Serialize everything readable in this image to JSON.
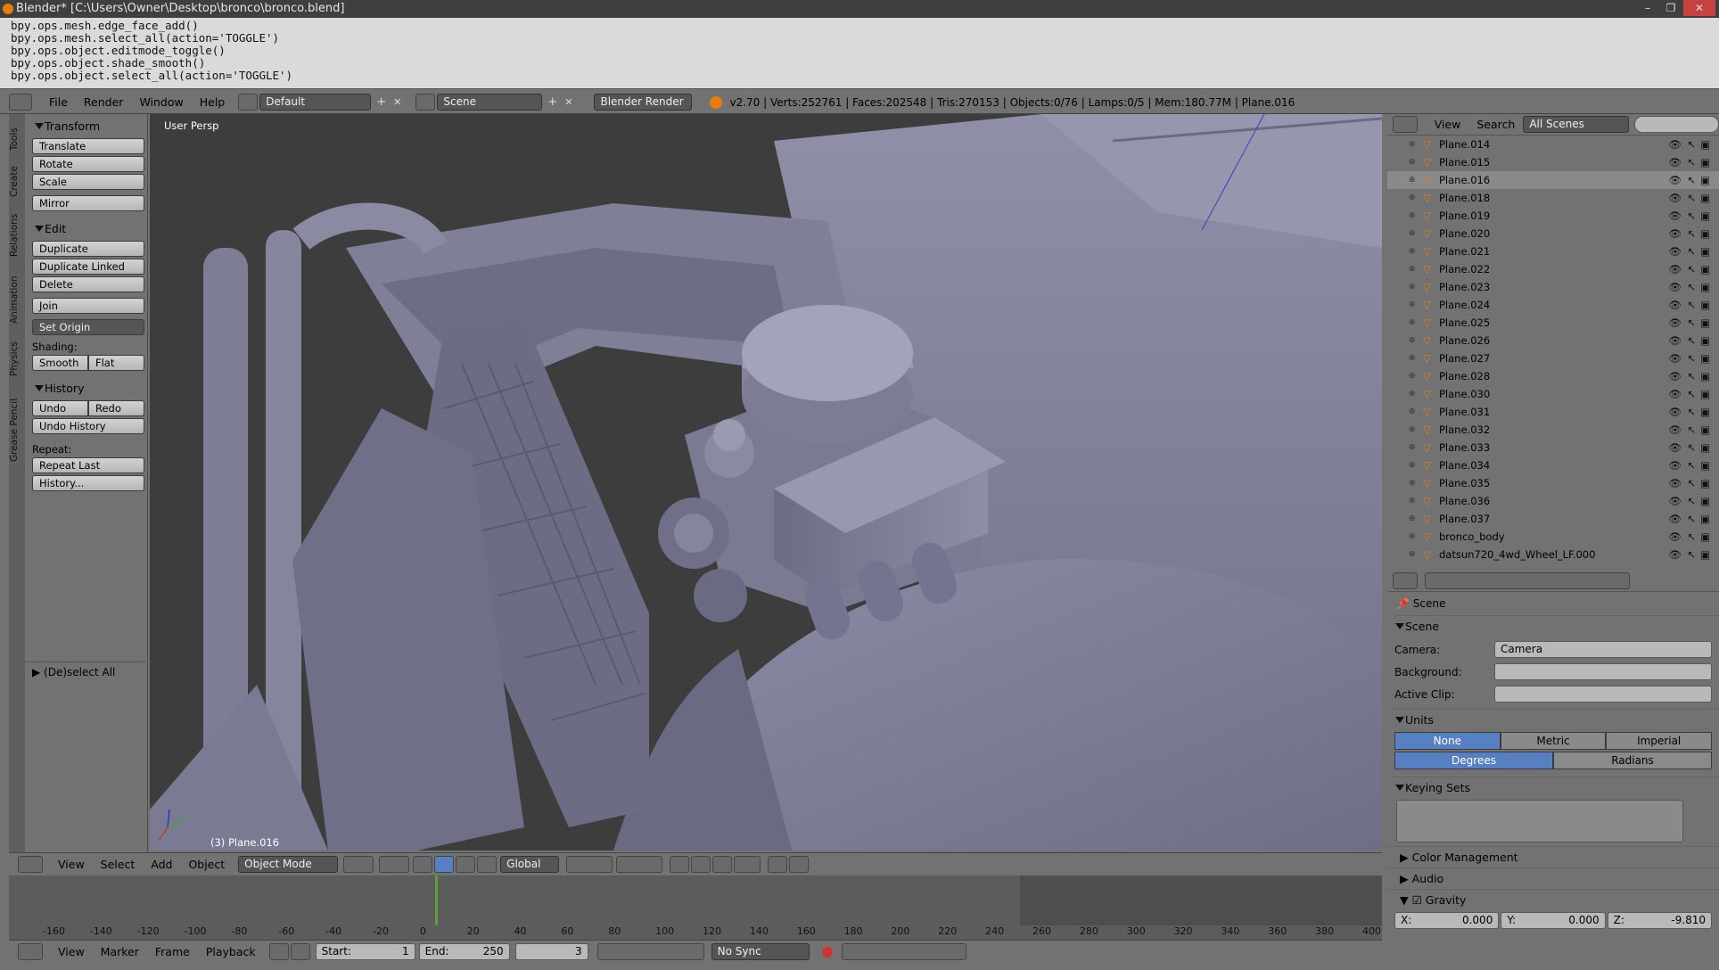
{
  "window": {
    "title": "Blender* [C:\\Users\\Owner\\Desktop\\bronco\\bronco.blend]",
    "buttons": [
      "–",
      "❐",
      "✕"
    ]
  },
  "info_log": [
    "bpy.ops.mesh.edge_face_add()",
    "bpy.ops.mesh.select_all(action='TOGGLE')",
    "bpy.ops.object.editmode_toggle()",
    "bpy.ops.object.shade_smooth()",
    "bpy.ops.object.select_all(action='TOGGLE')"
  ],
  "top_header": {
    "menus": [
      "File",
      "Render",
      "Window",
      "Help"
    ],
    "layout": "Default",
    "scene": "Scene",
    "engine": "Blender Render",
    "stats": "v2.70 | Verts:252761 | Faces:202548 | Tris:270153 | Objects:0/76 | Lamps:0/5 | Mem:180.77M | Plane.016"
  },
  "tool_shelf": {
    "tabs": [
      "Tools",
      "Create",
      "Relations",
      "Animation",
      "Physics",
      "Grease Pencil"
    ],
    "transform": {
      "title": "Transform",
      "buttons": [
        "Translate",
        "Rotate",
        "Scale",
        "Mirror"
      ]
    },
    "edit": {
      "title": "Edit",
      "buttons": [
        "Duplicate",
        "Duplicate Linked",
        "Delete",
        "Join"
      ],
      "set_origin": "Set Origin",
      "shading_label": "Shading:",
      "smooth": "Smooth",
      "flat": "Flat"
    },
    "history": {
      "title": "History",
      "undo": "Undo",
      "redo": "Redo",
      "undo_history": "Undo History",
      "repeat_label": "Repeat:",
      "repeat_last": "Repeat Last",
      "history": "History..."
    },
    "operator": "(De)select All"
  },
  "viewport": {
    "view_label": "User Persp",
    "object_label": "(3) Plane.016"
  },
  "viewport_header": {
    "menus": [
      "View",
      "Select",
      "Add",
      "Object"
    ],
    "mode": "Object Mode",
    "orientation": "Global"
  },
  "outliner": {
    "menus": [
      "View",
      "Search"
    ],
    "filter": "All Scenes",
    "items": [
      "Plane.014",
      "Plane.015",
      "Plane.016",
      "Plane.018",
      "Plane.019",
      "Plane.020",
      "Plane.021",
      "Plane.022",
      "Plane.023",
      "Plane.024",
      "Plane.025",
      "Plane.026",
      "Plane.027",
      "Plane.028",
      "Plane.030",
      "Plane.031",
      "Plane.032",
      "Plane.033",
      "Plane.034",
      "Plane.035",
      "Plane.036",
      "Plane.037",
      "bronco_body",
      "datsun720_4wd_Wheel_LF.000"
    ],
    "selected": "Plane.016"
  },
  "properties": {
    "breadcrumb": "Scene",
    "scene_panel": {
      "title": "Scene",
      "camera_label": "Camera:",
      "camera_value": "Camera",
      "background_label": "Background:",
      "clip_label": "Active Clip:"
    },
    "units_panel": {
      "title": "Units",
      "systems": [
        "None",
        "Metric",
        "Imperial"
      ],
      "rotation": [
        "Degrees",
        "Radians"
      ]
    },
    "keying_sets": "Keying Sets",
    "color_management": "Color Management",
    "audio": "Audio",
    "gravity": {
      "title": "Gravity",
      "x": "X:",
      "x_val": "0.000",
      "y": "Y:",
      "y_val": "0.000",
      "z": "Z:",
      "z_val": "-9.810"
    }
  },
  "timeline": {
    "ticks": [
      "-160",
      "-140",
      "-120",
      "-100",
      "-80",
      "-60",
      "-40",
      "-20",
      "0",
      "20",
      "40",
      "60",
      "80",
      "100",
      "120",
      "140",
      "160",
      "180",
      "200",
      "220",
      "240",
      "260",
      "280",
      "300",
      "320",
      "340",
      "360",
      "380",
      "400"
    ],
    "menus": [
      "View",
      "Marker",
      "Frame",
      "Playback"
    ],
    "start_label": "Start:",
    "start": "1",
    "end_label": "End:",
    "end": "250",
    "current": "3",
    "sync": "No Sync"
  },
  "colors": {
    "accent": "#5680c2",
    "selection": "#e87d0d"
  }
}
